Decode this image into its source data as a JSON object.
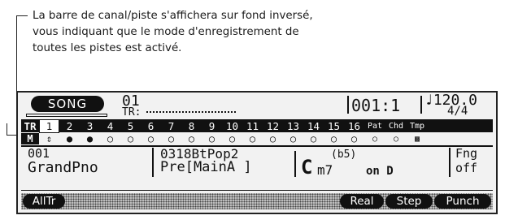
{
  "callout": {
    "lines": [
      "La barre de canal/piste s'affichera sur fond inversé,",
      "vous indiquant que le mode d'enregistrement de",
      "toutes les pistes est activé."
    ]
  },
  "lcd": {
    "mode_label": "SONG",
    "song_number": "01",
    "tr_label": "TR:",
    "measure": "001:1",
    "tempo": "♩120.0",
    "time_signature": "4/4",
    "track_header_label": "TR",
    "tracks": [
      "1",
      "2",
      "3",
      "4",
      "5",
      "6",
      "7",
      "8",
      "9",
      "10",
      "11",
      "12",
      "13",
      "14",
      "15",
      "16"
    ],
    "track_tags": [
      "Pat",
      "Chd",
      "Tmp"
    ],
    "status_label": "M",
    "status_marks": [
      "⇕",
      "●",
      "●",
      "○",
      "○",
      "○",
      "○",
      "○",
      "○",
      "○",
      "○",
      "○",
      "○",
      "○",
      "○",
      "○"
    ],
    "status_tag_marks": [
      "○",
      "○",
      "▩"
    ],
    "voice_number": "001",
    "voice_name": "GrandPno",
    "style_name": "0318BtPop2",
    "style_section": "Pre[MainA ]",
    "chord_root": "C",
    "chord_type": "m7",
    "chord_ext": "(b5)",
    "chord_on_label": "on",
    "chord_bass": "D",
    "fingering_label": "Fng",
    "fingering_value": "off",
    "softkeys": {
      "all_tr": "AllTr",
      "real": "Real",
      "step": "Step",
      "punch": "Punch"
    }
  }
}
